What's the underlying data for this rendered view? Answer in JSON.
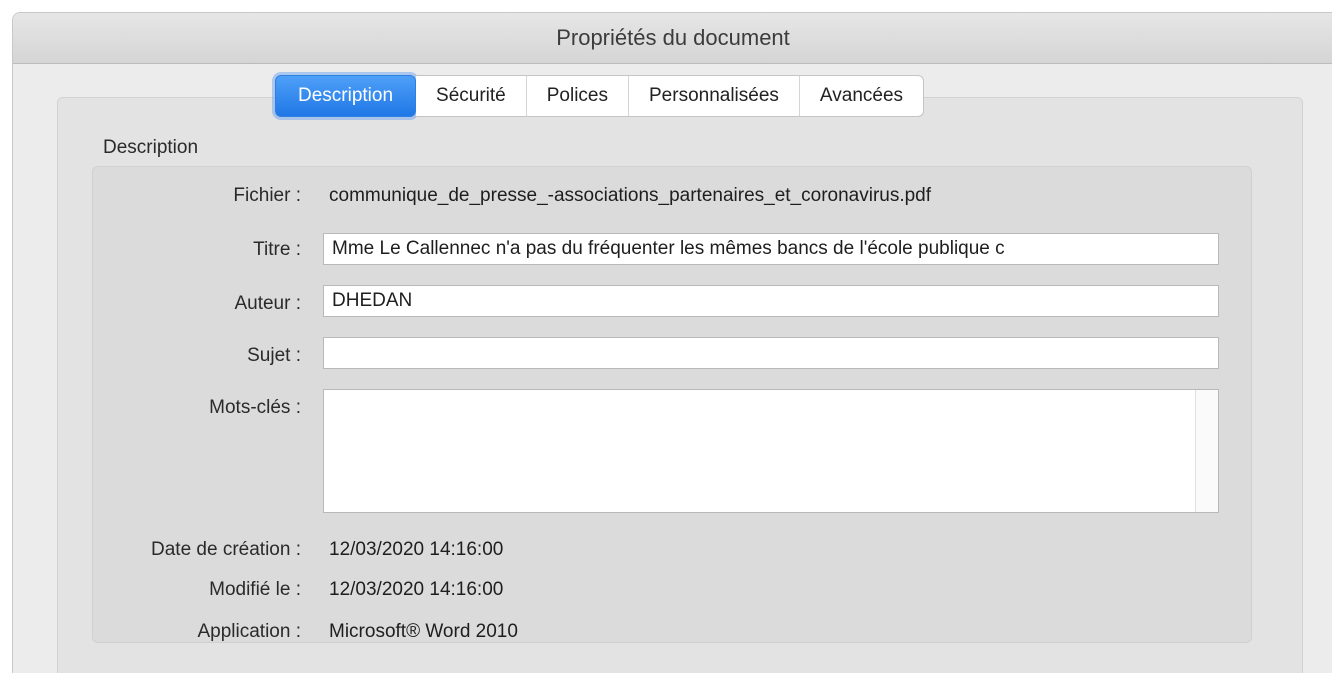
{
  "window": {
    "title": "Propriétés du document"
  },
  "tabs": [
    {
      "label": "Description",
      "active": true
    },
    {
      "label": "Sécurité",
      "active": false
    },
    {
      "label": "Polices",
      "active": false
    },
    {
      "label": "Personnalisées",
      "active": false
    },
    {
      "label": "Avancées",
      "active": false
    }
  ],
  "description": {
    "group_label": "Description",
    "fichier": {
      "label": "Fichier :",
      "value": "communique_de_presse_-associations_partenaires_et_coronavirus.pdf"
    },
    "titre": {
      "label": "Titre :",
      "value": "Mme Le Callennec n'a pas du fréquenter les mêmes bancs de l'école publique c"
    },
    "auteur": {
      "label": "Auteur :",
      "value": "DHEDAN"
    },
    "sujet": {
      "label": "Sujet :",
      "value": ""
    },
    "mots_cles": {
      "label": "Mots-clés :",
      "value": ""
    },
    "date_creation": {
      "label": "Date de création :",
      "value": "12/03/2020 14:16:00"
    },
    "modifie_le": {
      "label": "Modifié le :",
      "value": "12/03/2020 14:16:00"
    },
    "application": {
      "label": "Application :",
      "value": "Microsoft® Word 2010"
    }
  },
  "colors": {
    "active_tab": "#1f78e6",
    "window_bg": "#ececec"
  }
}
